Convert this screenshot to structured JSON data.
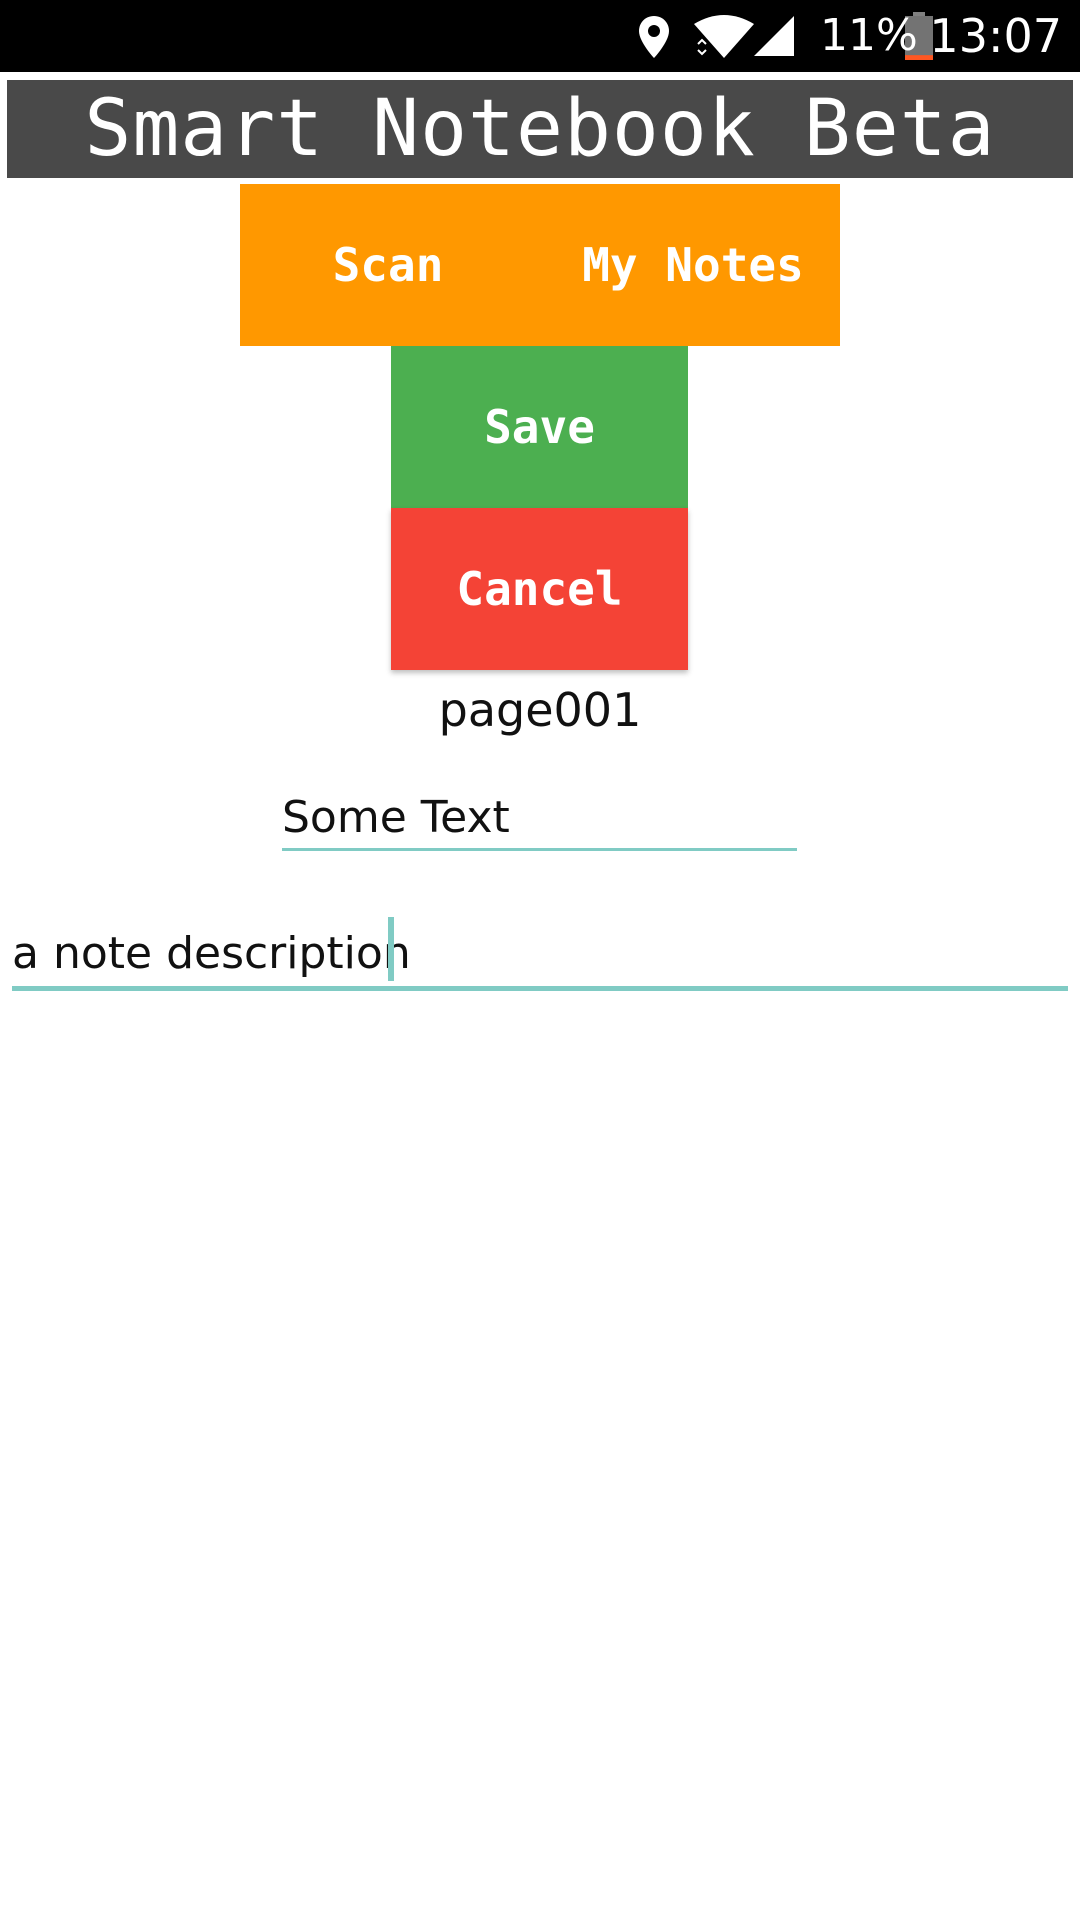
{
  "status_bar": {
    "battery_percent": "11%",
    "time": "13:07",
    "icons": [
      "location-icon",
      "wifi-icon",
      "signal-icon",
      "battery-icon"
    ],
    "battery_level_fraction": 0.11
  },
  "app": {
    "title": "Smart Notebook Beta"
  },
  "nav": {
    "scan_label": "Scan",
    "my_notes_label": "My Notes"
  },
  "actions": {
    "save_label": "Save",
    "cancel_label": "Cancel"
  },
  "page": {
    "name": "page001"
  },
  "form": {
    "title_value": "Some Text",
    "description_value": "a note description"
  },
  "colors": {
    "title_bar": "#494949",
    "nav_bar": "#ff9800",
    "save": "#4caf50",
    "cancel": "#f44336",
    "accent": "#80cbc4"
  }
}
